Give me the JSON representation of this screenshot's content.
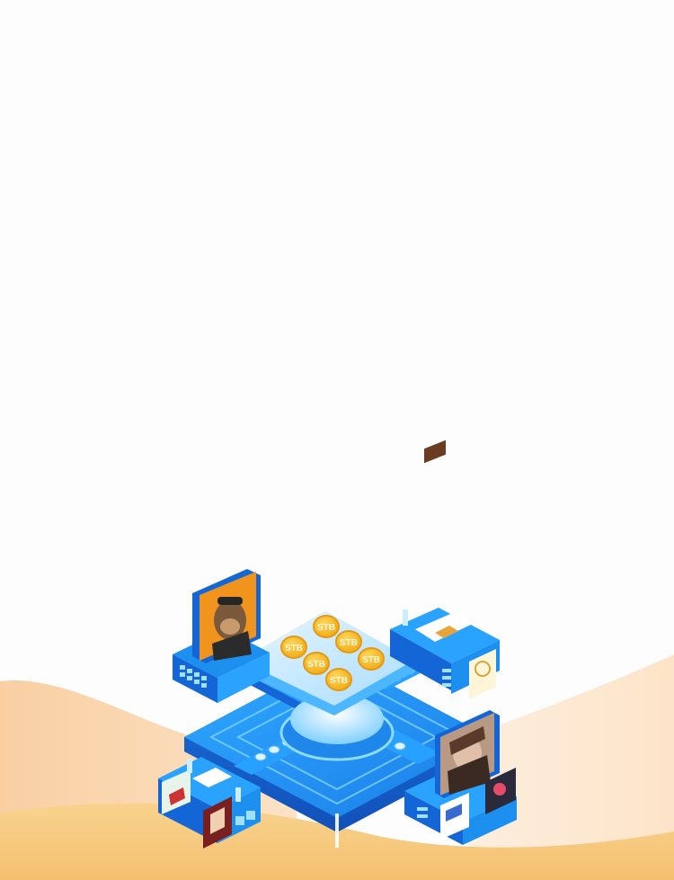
{
  "colors": {
    "background": "#fdfdfe",
    "wave_peach": "#f9d3a8",
    "wave_light": "#fbe6cc",
    "wave_gold": "#f6c67a",
    "platform_blue": "#1d8fef",
    "platform_light": "#5fc5ff",
    "platform_dark": "#1466d6",
    "coin_gold": "#f5b81c",
    "coin_edge": "#e49a10"
  },
  "coins": [
    {
      "label": "STB"
    },
    {
      "label": "STB"
    },
    {
      "label": "STB"
    },
    {
      "label": "STB"
    },
    {
      "label": "STB"
    },
    {
      "label": "STB"
    }
  ],
  "nft_cards": [
    {
      "name": "ape-portrait-card"
    },
    {
      "name": "warrior-portrait-card"
    },
    {
      "name": "pixel-art-card"
    },
    {
      "name": "anime-girl-card"
    },
    {
      "name": "sneaker-card"
    },
    {
      "name": "red-portrait-card"
    }
  ]
}
